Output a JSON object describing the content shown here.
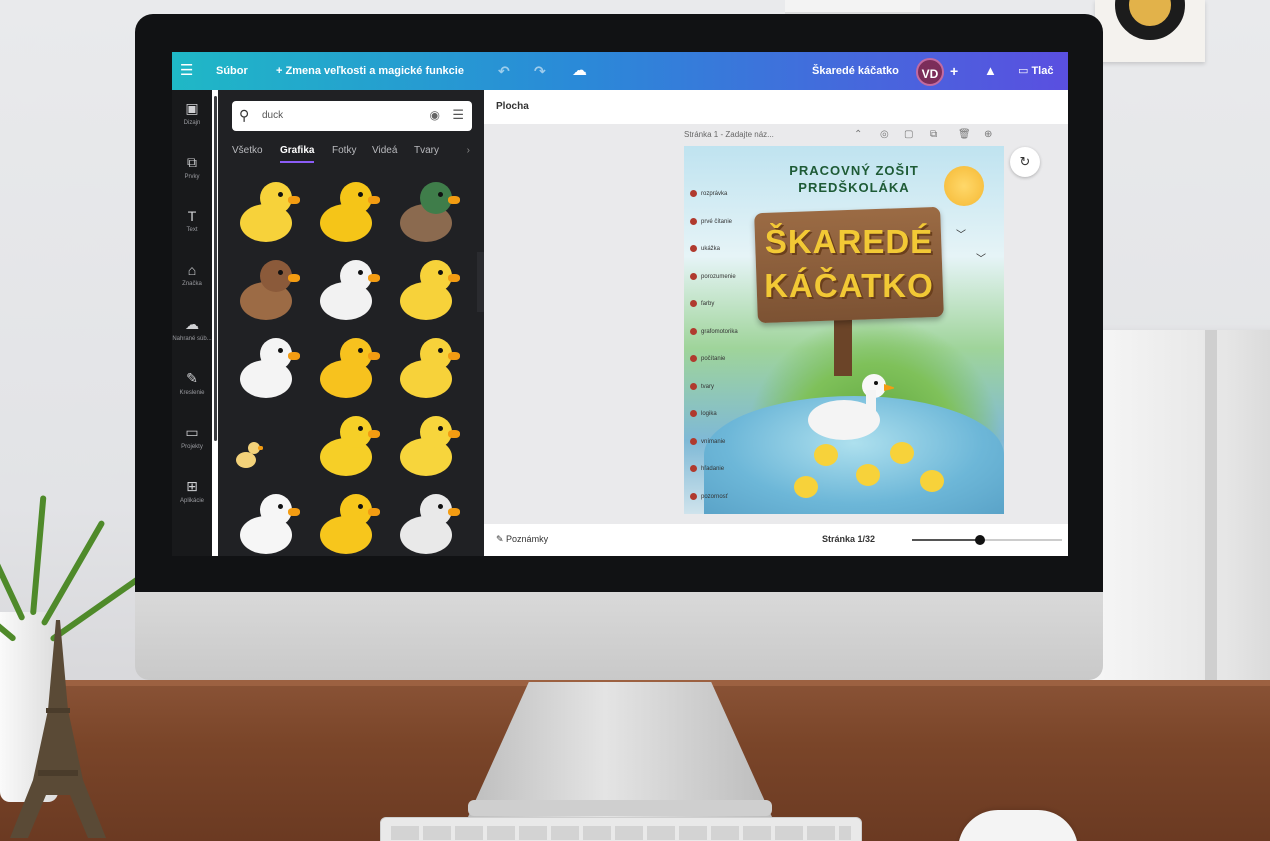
{
  "topbar": {
    "file_label": "Súbor",
    "resize_label": "+ Zmena veľkosti a magické funkcie",
    "project_title": "Škaredé káčatko",
    "avatar_initials": "VD",
    "print_label": "Tlač",
    "icons": [
      "menu-icon",
      "undo-icon",
      "redo-icon",
      "cloud-sync-icon",
      "plus-icon",
      "analytics-icon",
      "print-icon"
    ]
  },
  "rail": {
    "items": [
      {
        "icon": "design-icon",
        "label": "Dizajn"
      },
      {
        "icon": "elements-icon",
        "label": "Prvky"
      },
      {
        "icon": "text-icon",
        "label": "Text"
      },
      {
        "icon": "brand-icon",
        "label": "Značka"
      },
      {
        "icon": "uploads-icon",
        "label": "Nahrané súb..."
      },
      {
        "icon": "draw-icon",
        "label": "Kreslenie"
      },
      {
        "icon": "projects-icon",
        "label": "Projekty"
      },
      {
        "icon": "apps-icon",
        "label": "Aplikácie"
      }
    ]
  },
  "panel": {
    "search_value": "duck",
    "tabs": [
      "Všetko",
      "Grafika",
      "Fotky",
      "Videá",
      "Tvary"
    ],
    "active_tab": 1,
    "results_count": 15
  },
  "canvas": {
    "label": "Plocha",
    "page_title": "Stránka 1 - Zadajte náz...",
    "doc_title_line1": "PRACOVNÝ ZOŠIT",
    "doc_title_line2": "PREDŠKOLÁKA",
    "doc_title_main1": "ŠKAREDÉ",
    "doc_title_main2": "KÁČATKO",
    "toc": [
      "rozprávka",
      "prvé čítanie",
      "ukážka",
      "porozumenie",
      "farby",
      "grafomotorika",
      "počítanie",
      "tvary",
      "logika",
      "vnímanie",
      "hľadanie",
      "pozornosť",
      "sluchová analýza"
    ],
    "notes_label": "Poznámky",
    "page_number": "Stránka 1/32",
    "zoom_level": 0.45
  },
  "colors": {
    "topbar_start": "#1fb8c6",
    "topbar_end": "#5a4fe0",
    "active_tab_underline": "#8b5cf6",
    "title_yellow": "#f2c935"
  }
}
